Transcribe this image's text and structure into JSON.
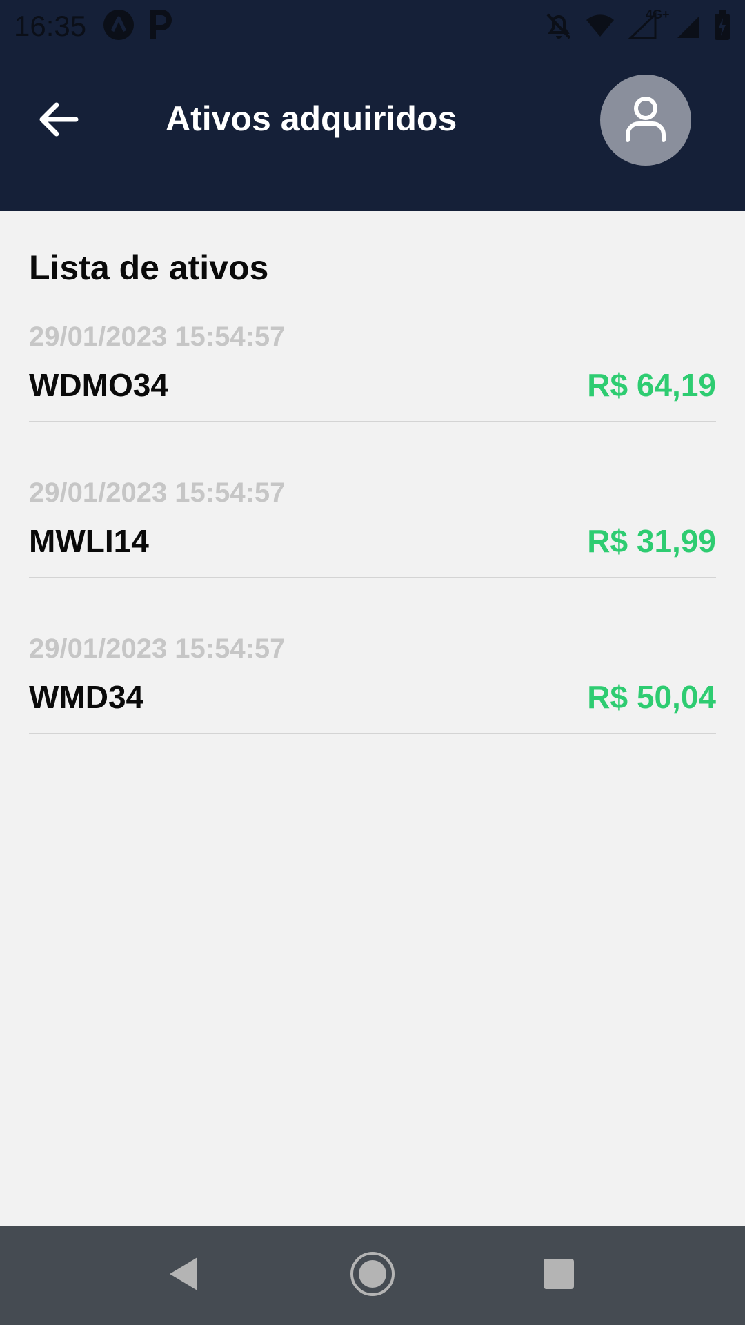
{
  "status_bar": {
    "time": "16:35",
    "network_label": "4G+"
  },
  "header": {
    "title": "Ativos adquiridos"
  },
  "section": {
    "title": "Lista de ativos"
  },
  "assets": [
    {
      "date": "29/01/2023 15:54:57",
      "ticker": "WDMO34",
      "price": "R$ 64,19"
    },
    {
      "date": "29/01/2023 15:54:57",
      "ticker": "MWLI14",
      "price": "R$ 31,99"
    },
    {
      "date": "29/01/2023 15:54:57",
      "ticker": "WMD34",
      "price": "R$ 50,04"
    }
  ],
  "colors": {
    "header_bg": "#152038",
    "price_green": "#2ecc71",
    "avatar_bg": "#8a8f9c",
    "nav_bg": "#454b52"
  },
  "icons": {
    "back": "arrow-left-icon",
    "avatar": "user-icon",
    "nav_back": "triangle-back-icon",
    "nav_home": "circle-home-icon",
    "nav_recents": "square-recents-icon"
  }
}
